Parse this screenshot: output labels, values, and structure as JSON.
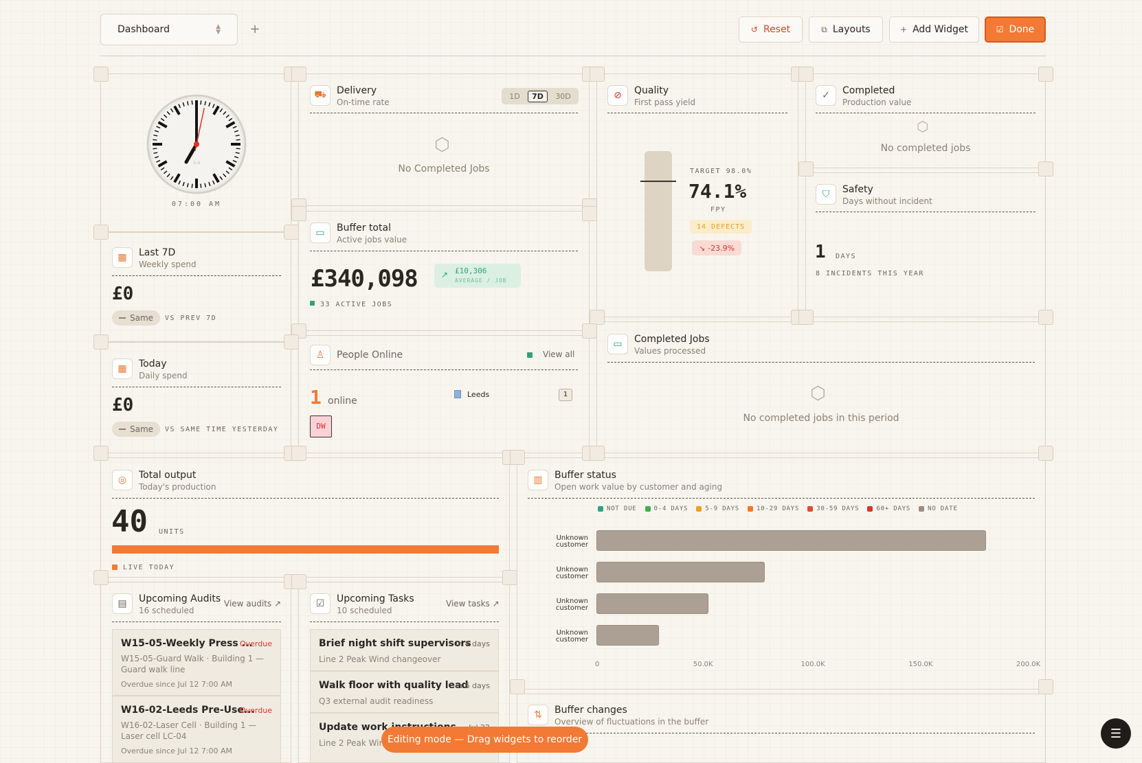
{
  "toolbar": {
    "dashboard_select": "Dashboard",
    "reset_label": "Reset",
    "layouts_label": "Layouts",
    "add_widget_label": "Add Widget",
    "done_label": "Done"
  },
  "clock": {
    "time_label": "07:00 AM",
    "brand": "SLN",
    "hour": 7,
    "minute": 0,
    "second": 2
  },
  "delivery": {
    "title": "Delivery",
    "subtitle": "On-time rate",
    "ranges": [
      "1D",
      "7D",
      "30D"
    ],
    "selected_range": "7D",
    "empty": "No Completed Jobs"
  },
  "quality": {
    "title": "Quality",
    "subtitle": "First pass yield",
    "target": "TARGET 98.0%",
    "value": "74.1%",
    "unit": "FPY",
    "defects": "14 DEFECTS",
    "change": "-23.9%"
  },
  "completed": {
    "title": "Completed",
    "subtitle": "Production value",
    "empty": "No completed jobs"
  },
  "safety": {
    "title": "Safety",
    "subtitle": "Days without incident",
    "value": "1",
    "unit": "DAYS",
    "note": "8 INCIDENTS THIS YEAR"
  },
  "last7d": {
    "title": "Last 7D",
    "subtitle": "Weekly spend",
    "value": "£0",
    "badge": "Same",
    "compare": "VS PREV 7D"
  },
  "buffer_total": {
    "title": "Buffer total",
    "subtitle": "Active jobs value",
    "value": "£340,098",
    "avg_value": "£10,306",
    "avg_label": "AVERAGE / JOB",
    "active_jobs": "33 ACTIVE JOBS"
  },
  "completed_jobs": {
    "title": "Completed Jobs",
    "subtitle": "Values processed",
    "empty": "No completed jobs in this period"
  },
  "today": {
    "title": "Today",
    "subtitle": "Daily spend",
    "value": "£0",
    "badge": "Same",
    "compare": "VS SAME TIME YESTERDAY"
  },
  "people": {
    "title": "People Online",
    "view_all": "View all",
    "count": "1",
    "count_label": "online",
    "location": "Leeds",
    "location_count": "1",
    "avatar": "DW"
  },
  "total_output": {
    "title": "Total output",
    "subtitle": "Today's production",
    "value": "40",
    "unit": "UNITS",
    "live": "LIVE TODAY",
    "progress": 1.0
  },
  "buffer_status": {
    "title": "Buffer status",
    "subtitle": "Open work value by customer and aging",
    "legend": [
      {
        "label": "NOT DUE",
        "color": "#2fa37a"
      },
      {
        "label": "0-4 DAYS",
        "color": "#3fae4f"
      },
      {
        "label": "5-9 DAYS",
        "color": "#f0a020"
      },
      {
        "label": "10-29 DAYS",
        "color": "#f07a25"
      },
      {
        "label": "30-59 DAYS",
        "color": "#e04a30"
      },
      {
        "label": "60+ DAYS",
        "color": "#d8352a"
      },
      {
        "label": "NO DATE",
        "color": "#9a8d82"
      }
    ]
  },
  "chart_data": {
    "type": "bar",
    "orientation": "horizontal",
    "stacked": true,
    "categories": [
      "Unknown customer",
      "Unknown customer",
      "Unknown customer",
      "Unknown customer"
    ],
    "series": [
      {
        "name": "NO DATE",
        "values": [
          181000,
          78000,
          52000,
          29000
        ]
      }
    ],
    "xlim": [
      0,
      200000
    ],
    "xticks": [
      "0",
      "50.0K",
      "100.0K",
      "150.0K",
      "200.0K"
    ],
    "legend_position": "top"
  },
  "buffer_changes": {
    "title": "Buffer changes",
    "subtitle": "Overview of fluctuations in the buffer"
  },
  "audits": {
    "title": "Upcoming Audits",
    "subtitle": "16 scheduled",
    "link": "View audits",
    "items": [
      {
        "title": "W15-05-Weekly Press ...",
        "status": "Overdue",
        "line1": "W15-05-Guard Walk · Building 1 —",
        "line2": "Guard walk line",
        "line3": "Overdue since Jul 12 7:00 AM"
      },
      {
        "title": "W16-02-Leeds Pre-Use...",
        "status": "Overdue",
        "line1": "W16-02-Laser Cell · Building 1 —",
        "line2": "Laser cell LC-04",
        "line3": "Overdue since Jul 12 7:00 AM"
      }
    ]
  },
  "tasks": {
    "title": "Upcoming Tasks",
    "subtitle": "10 scheduled",
    "link": "View tasks",
    "items": [
      {
        "title": "Brief night shift supervisors",
        "due": "in 4 days",
        "desc": "Line 2 Peak Wind changeover"
      },
      {
        "title": "Walk floor with quality lead",
        "due": "in 6 days",
        "desc": "Q3 external audit readiness"
      },
      {
        "title": "Update work instructions",
        "due": "Jul 22",
        "desc": "Line 2 Peak Wind"
      }
    ]
  },
  "toast": "Editing mode — Drag widgets to reorder"
}
